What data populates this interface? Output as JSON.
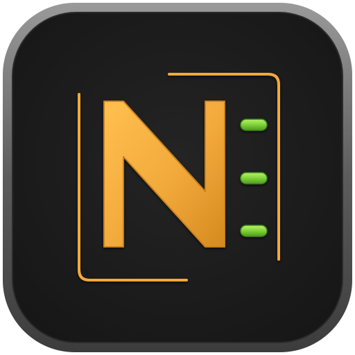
{
  "icon": {
    "name": "notebook-app-icon",
    "glyph_letter": "N",
    "colors": {
      "frame_outer": "#6b6b6b",
      "frame_inner": "#3a3a3a",
      "background": "#1c1c1c",
      "accent": "#f2a93b",
      "accent_dark": "#c9811c",
      "indicator": "#7fd23a",
      "indicator_dark": "#3f8a16"
    },
    "indicators": [
      {
        "name": "indicator-dot-top",
        "state": "on"
      },
      {
        "name": "indicator-dot-middle",
        "state": "on"
      },
      {
        "name": "indicator-dot-bottom",
        "state": "on"
      }
    ]
  }
}
